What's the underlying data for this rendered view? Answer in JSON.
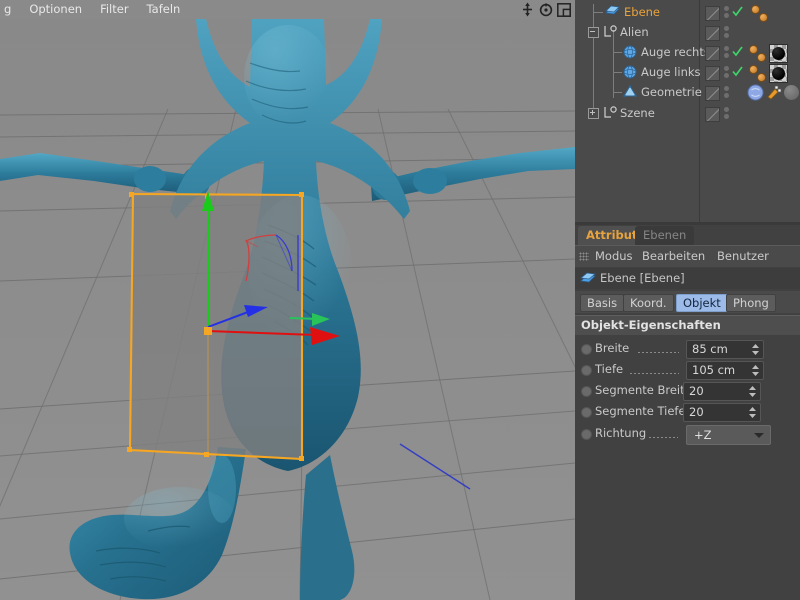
{
  "menubar": {
    "items": [
      "g",
      "Optionen",
      "Filter",
      "Tafeln"
    ],
    "icons": [
      "move-axis-icon",
      "rotate-icon",
      "maximize-viewport-icon"
    ]
  },
  "object_manager": {
    "rows": [
      {
        "name": "Ebene",
        "icon": "plane-object-icon",
        "selected": true,
        "indent": 28,
        "expander": null,
        "check": true,
        "tags": 2,
        "material": null
      },
      {
        "name": "Alien",
        "icon": "null-object-icon",
        "selected": false,
        "indent": 18,
        "expander": "minus",
        "check": false,
        "tags": 0,
        "material": null
      },
      {
        "name": "Auge rechts",
        "icon": "sphere-object-icon",
        "selected": false,
        "indent": 38,
        "expander": null,
        "check": true,
        "tags": 2,
        "material": "black-sphere-thumb"
      },
      {
        "name": "Auge links",
        "icon": "sphere-object-icon",
        "selected": false,
        "indent": 38,
        "expander": null,
        "check": true,
        "tags": 2,
        "material": "black-sphere-thumb"
      },
      {
        "name": "Geometrie",
        "icon": "polygon-object-icon",
        "selected": false,
        "indent": 38,
        "expander": null,
        "check": false,
        "tags": 0,
        "material": "blue-sphere-thumb"
      },
      {
        "name": "Szene",
        "icon": "null-object-icon",
        "selected": false,
        "indent": 18,
        "expander": "plus",
        "check": false,
        "tags": 0,
        "material": null
      }
    ],
    "column_icons": {
      "visibility_toggle": "hatched-square-icon",
      "editor_dot": "editor-visibility-dot-icon",
      "render_dot": "render-visibility-dot-icon",
      "enabled_check": "green-check-icon"
    }
  },
  "attribute_manager": {
    "tabs": [
      {
        "label": "Attribute",
        "active": true
      },
      {
        "label": "Ebenen",
        "active": false
      }
    ],
    "menu": [
      "Modus",
      "Bearbeiten",
      "Benutzer"
    ],
    "object_header": {
      "label": "Ebene [Ebene]",
      "icon": "plane-object-icon"
    },
    "property_tabs": [
      {
        "label": "Basis",
        "active": false
      },
      {
        "label": "Koord.",
        "active": false
      },
      {
        "label": "Objekt",
        "active": true
      },
      {
        "label": "Phong",
        "active": false
      }
    ],
    "section_title": "Objekt-Eigenschaften",
    "properties": [
      {
        "label": "Breite",
        "value": "85 cm",
        "type": "number"
      },
      {
        "label": "Tiefe",
        "value": "105 cm",
        "type": "number"
      },
      {
        "label": "Segmente Breite",
        "value": "20",
        "type": "number"
      },
      {
        "label": "Segmente Tiefe",
        "value": "20",
        "type": "number"
      },
      {
        "label": "Richtung",
        "value": "+Z",
        "type": "dropdown"
      }
    ]
  },
  "viewport": {
    "scene_objects": [
      "alien-character-mesh",
      "plane-object-selected",
      "ground-grid"
    ],
    "gizmo_axes": [
      "x-axis-red",
      "y-axis-green",
      "z-axis-blue"
    ],
    "selection_color": "#f5a623",
    "mesh_color": "#2a7a9c",
    "background_color": "#8d8d8d"
  },
  "colors": {
    "accent_orange": "#e8a33d",
    "tab_active_blue": "#9cbbe8",
    "panel_bg": "#414141",
    "menubar_bg": "#8a8a8a"
  }
}
